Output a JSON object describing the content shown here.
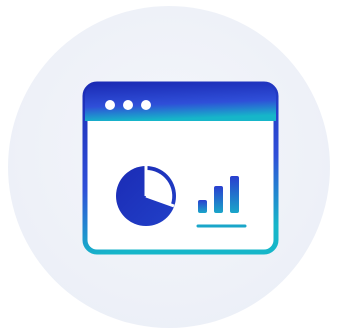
{
  "icon": {
    "name": "analytics-dashboard-window-icon",
    "elements": [
      "window-frame",
      "title-bar-dots",
      "pie-chart",
      "bar-chart",
      "baseline"
    ]
  },
  "colors": {
    "background": "#ffffff",
    "badge": "#eef1f8",
    "primary_dark": "#1b2bb5",
    "primary_mid": "#2f4fd8",
    "accent_cyan": "#16b6c9",
    "window_fill": "#ffffff"
  }
}
